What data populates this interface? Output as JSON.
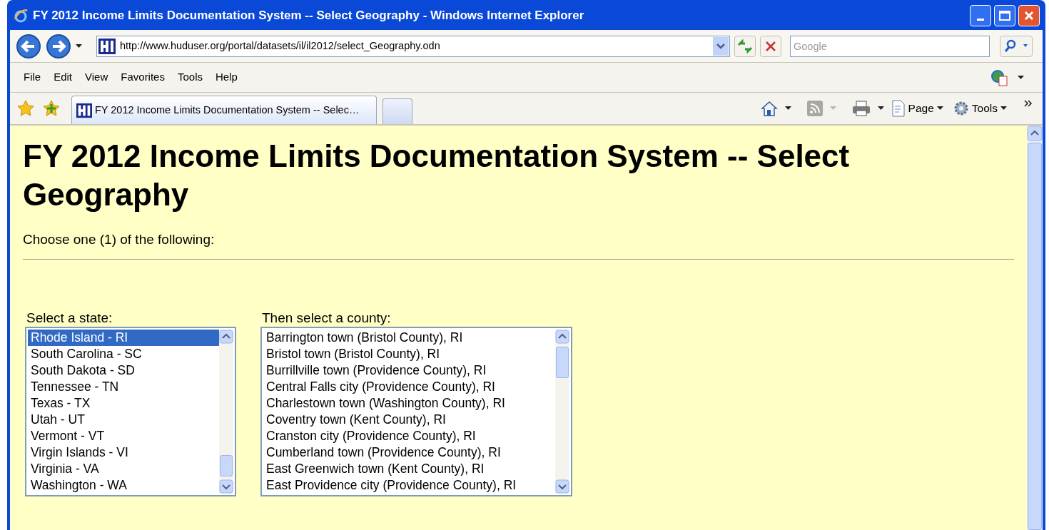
{
  "window": {
    "title": "FY 2012 Income Limits Documentation System -- Select Geography - Windows Internet Explorer"
  },
  "address_bar": {
    "url": "http://www.huduser.org/portal/datasets/il/il2012/select_Geography.odn"
  },
  "search": {
    "placeholder": "Google"
  },
  "menu": [
    "File",
    "Edit",
    "View",
    "Favorites",
    "Tools",
    "Help"
  ],
  "tabs": [
    {
      "label": "FY 2012 Income Limits Documentation System -- Selec…",
      "selected": true
    }
  ],
  "command_bar": [
    {
      "label": "Page"
    },
    {
      "label": "Tools"
    }
  ],
  "page": {
    "heading": "FY 2012 Income Limits Documentation System -- Select Geography",
    "instruction": "Choose one (1) of the following:",
    "state_list": {
      "label": "Select a state:",
      "items": [
        {
          "label": "Rhode Island - RI",
          "selected": true
        },
        {
          "label": "South Carolina - SC",
          "selected": false
        },
        {
          "label": "South Dakota - SD",
          "selected": false
        },
        {
          "label": "Tennessee - TN",
          "selected": false
        },
        {
          "label": "Texas - TX",
          "selected": false
        },
        {
          "label": "Utah - UT",
          "selected": false
        },
        {
          "label": "Vermont - VT",
          "selected": false
        },
        {
          "label": "Virgin Islands - VI",
          "selected": false
        },
        {
          "label": "Virginia - VA",
          "selected": false
        },
        {
          "label": "Washington - WA",
          "selected": false
        }
      ]
    },
    "county_list": {
      "label": "Then select a county:",
      "items": [
        {
          "label": "Barrington town (Bristol County), RI",
          "selected": false
        },
        {
          "label": "Bristol town (Bristol County), RI",
          "selected": false
        },
        {
          "label": "Burrillville town (Providence County), RI",
          "selected": false
        },
        {
          "label": "Central Falls city (Providence County), RI",
          "selected": false
        },
        {
          "label": "Charlestown town (Washington County), RI",
          "selected": false
        },
        {
          "label": "Coventry town (Kent County), RI",
          "selected": false
        },
        {
          "label": "Cranston city (Providence County), RI",
          "selected": false
        },
        {
          "label": "Cumberland town (Providence County), RI",
          "selected": false
        },
        {
          "label": "East Greenwich town (Kent County), RI",
          "selected": false
        },
        {
          "label": "East Providence city (Providence County), RI",
          "selected": false
        }
      ]
    }
  }
}
